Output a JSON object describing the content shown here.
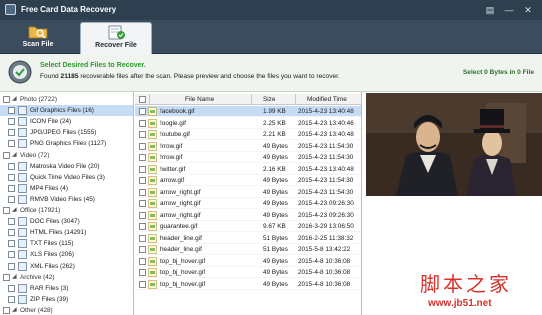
{
  "app": {
    "title": "Free Card Data Recovery"
  },
  "toolbar": {
    "tabs": [
      {
        "label": "Scan File",
        "icon": "scan-folder-icon"
      },
      {
        "label": "Recover File",
        "icon": "recover-file-icon"
      }
    ]
  },
  "info": {
    "heading": "Select Desired Files to Recover.",
    "found_prefix": "Found ",
    "found_count": "21185",
    "found_suffix": " recoverable files after the scan. Please preview and choose the files you want to recover.",
    "selection": "Select 0 Bytes in 0 File",
    "accent": "#2c9a2c"
  },
  "tree": [
    {
      "label": "Photo (2722)",
      "type": "category",
      "icon": "photo-icon"
    },
    {
      "label": "Gif Graphics Files (16)",
      "type": "file-type",
      "icon": "gif-icon",
      "selected": true
    },
    {
      "label": "ICON File (24)",
      "type": "file-type",
      "icon": "ico-icon"
    },
    {
      "label": "JPG/JPEG Files (1555)",
      "type": "file-type",
      "icon": "jpg-icon"
    },
    {
      "label": "PNG Graphics Files (1127)",
      "type": "file-type",
      "icon": "png-icon"
    },
    {
      "label": "Video (72)",
      "type": "category",
      "icon": "video-icon"
    },
    {
      "label": "Matroska Video File (20)",
      "type": "file-type",
      "icon": "mkv-icon"
    },
    {
      "label": "Quick Time Video Files (3)",
      "type": "file-type",
      "icon": "mov-icon"
    },
    {
      "label": "MP4 Files (4)",
      "type": "file-type",
      "icon": "mp4-icon"
    },
    {
      "label": "RMVB Video Files (45)",
      "type": "file-type",
      "icon": "rmvb-icon"
    },
    {
      "label": "Office (17921)",
      "type": "category",
      "icon": "office-icon"
    },
    {
      "label": "DOC Files (3047)",
      "type": "file-type",
      "icon": "doc-icon"
    },
    {
      "label": "HTML Files (14291)",
      "type": "file-type",
      "icon": "html-icon"
    },
    {
      "label": "TXT Files (115)",
      "type": "file-type",
      "icon": "txt-icon"
    },
    {
      "label": "XLS Files (206)",
      "type": "file-type",
      "icon": "xls-icon"
    },
    {
      "label": "XML Files (262)",
      "type": "file-type",
      "icon": "xml-icon"
    },
    {
      "label": "Archive (42)",
      "type": "category",
      "icon": "archive-icon"
    },
    {
      "label": "RAR Files (3)",
      "type": "file-type",
      "icon": "rar-icon"
    },
    {
      "label": "ZIP Files (39)",
      "type": "file-type",
      "icon": "zip-icon"
    },
    {
      "label": "Other (428)",
      "type": "category",
      "icon": "other-icon"
    }
  ],
  "list": {
    "columns": [
      "File Name",
      "Size",
      "Modified Time"
    ],
    "rows": [
      {
        "name": "!acebook.gif",
        "size": "1.99 KB",
        "time": "2015-4-23 13:40:48",
        "selected": true
      },
      {
        "name": "!oogle.gif",
        "size": "2.25 KB",
        "time": "2015-4-23 13:40:46"
      },
      {
        "name": "!outube.gif",
        "size": "2.21 KB",
        "time": "2015-4-23 13:40:48"
      },
      {
        "name": "!rrow.gif",
        "size": "49 Bytes",
        "time": "2015-4-23 11:54:30"
      },
      {
        "name": "!rrow.gif",
        "size": "49 Bytes",
        "time": "2015-4-23 11:54:30"
      },
      {
        "name": "!witter.gif",
        "size": "2.16 KB",
        "time": "2015-4-23 13:40:48"
      },
      {
        "name": "arrow.gif",
        "size": "49 Bytes",
        "time": "2015-4-23 11:54:30"
      },
      {
        "name": "arrow_right.gif",
        "size": "49 Bytes",
        "time": "2015-4-23 11:54:30"
      },
      {
        "name": "arrow_right.gif",
        "size": "49 Bytes",
        "time": "2015-4-23 09:26:30"
      },
      {
        "name": "arrow_right.gif",
        "size": "49 Bytes",
        "time": "2015-4-23 09:26:30"
      },
      {
        "name": "guarantee.gif",
        "size": "9.67 KB",
        "time": "2016-3-29 13:06:50"
      },
      {
        "name": "header_line.gif",
        "size": "51 Bytes",
        "time": "2016-2-25 11:38:32"
      },
      {
        "name": "header_line.gif",
        "size": "51 Bytes",
        "time": "2015-5-8 13:42:22"
      },
      {
        "name": "top_bj_hover.gif",
        "size": "49 Bytes",
        "time": "2015-4-8 10:36:08"
      },
      {
        "name": "top_bj_hover.gif",
        "size": "49 Bytes",
        "time": "2015-4-8 10:36:08"
      },
      {
        "name": "top_bj_hover.gif",
        "size": "49 Bytes",
        "time": "2015-4-8 10:36:08"
      }
    ]
  },
  "preview": {
    "image": "two-cartoon-gentlemen-preview"
  },
  "watermark": {
    "text": "脚本之家",
    "url": "www.jb51.net",
    "color": "#d8322b"
  }
}
